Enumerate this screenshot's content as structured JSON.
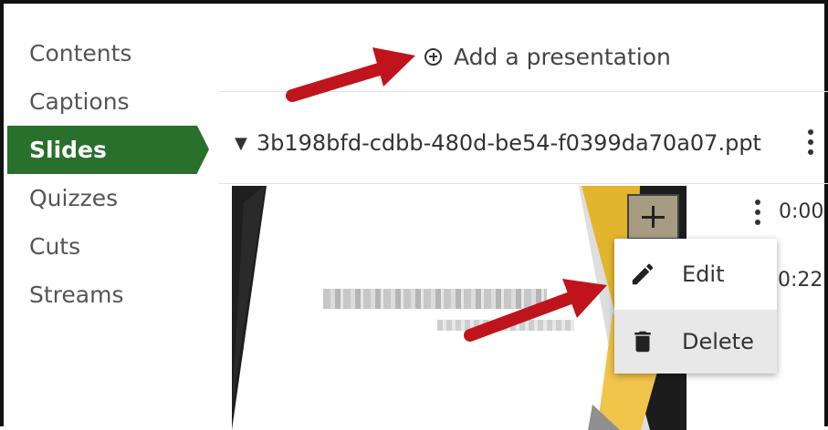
{
  "sidebar": {
    "items": [
      {
        "label": "Contents",
        "active": false
      },
      {
        "label": "Captions",
        "active": false
      },
      {
        "label": "Slides",
        "active": true
      },
      {
        "label": "Quizzes",
        "active": false
      },
      {
        "label": "Cuts",
        "active": false
      },
      {
        "label": "Streams",
        "active": false
      }
    ]
  },
  "toolbar": {
    "add_presentation_label": "Add a presentation"
  },
  "file": {
    "name": "3b198bfd-cdbb-480d-be54-f0399da70a07.ppt"
  },
  "slides": [
    {
      "time": "0:00"
    },
    {
      "time": "0:22"
    }
  ],
  "context_menu": {
    "edit_label": "Edit",
    "delete_label": "Delete"
  },
  "colors": {
    "active_nav": "#28702c",
    "annotation_arrow": "#c0141c",
    "slide_accent_gold": "#e3b52c"
  }
}
